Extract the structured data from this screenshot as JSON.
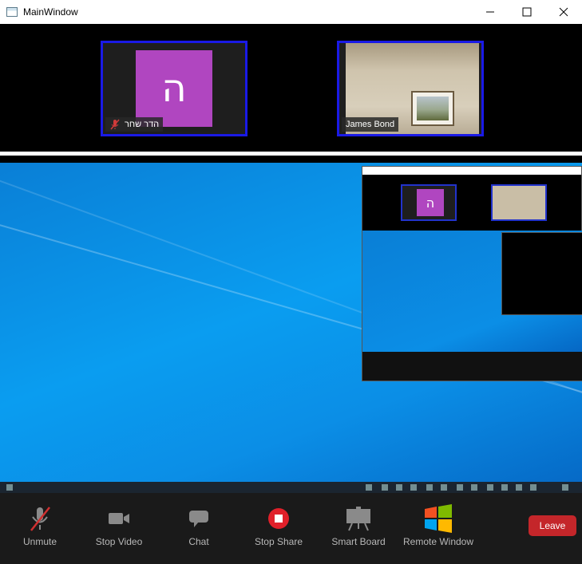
{
  "window": {
    "title": "MainWindow"
  },
  "participants": [
    {
      "name": "הדר שחר",
      "avatar_letter": "ה",
      "avatar_color": "#b046c0",
      "muted": true
    },
    {
      "name": "James Bond",
      "video": true
    }
  ],
  "toolbar": {
    "unmute": "Unmute",
    "stop_video": "Stop Video",
    "chat": "Chat",
    "stop_share": "Stop Share",
    "smart_board": "Smart Board",
    "remote_window": "Remote Window",
    "leave": "Leave"
  },
  "colors": {
    "tile_border": "#1a1ae6",
    "leave": "#c4262a",
    "share_bg": "#0a9df0",
    "stop_share": "#e0202a"
  }
}
